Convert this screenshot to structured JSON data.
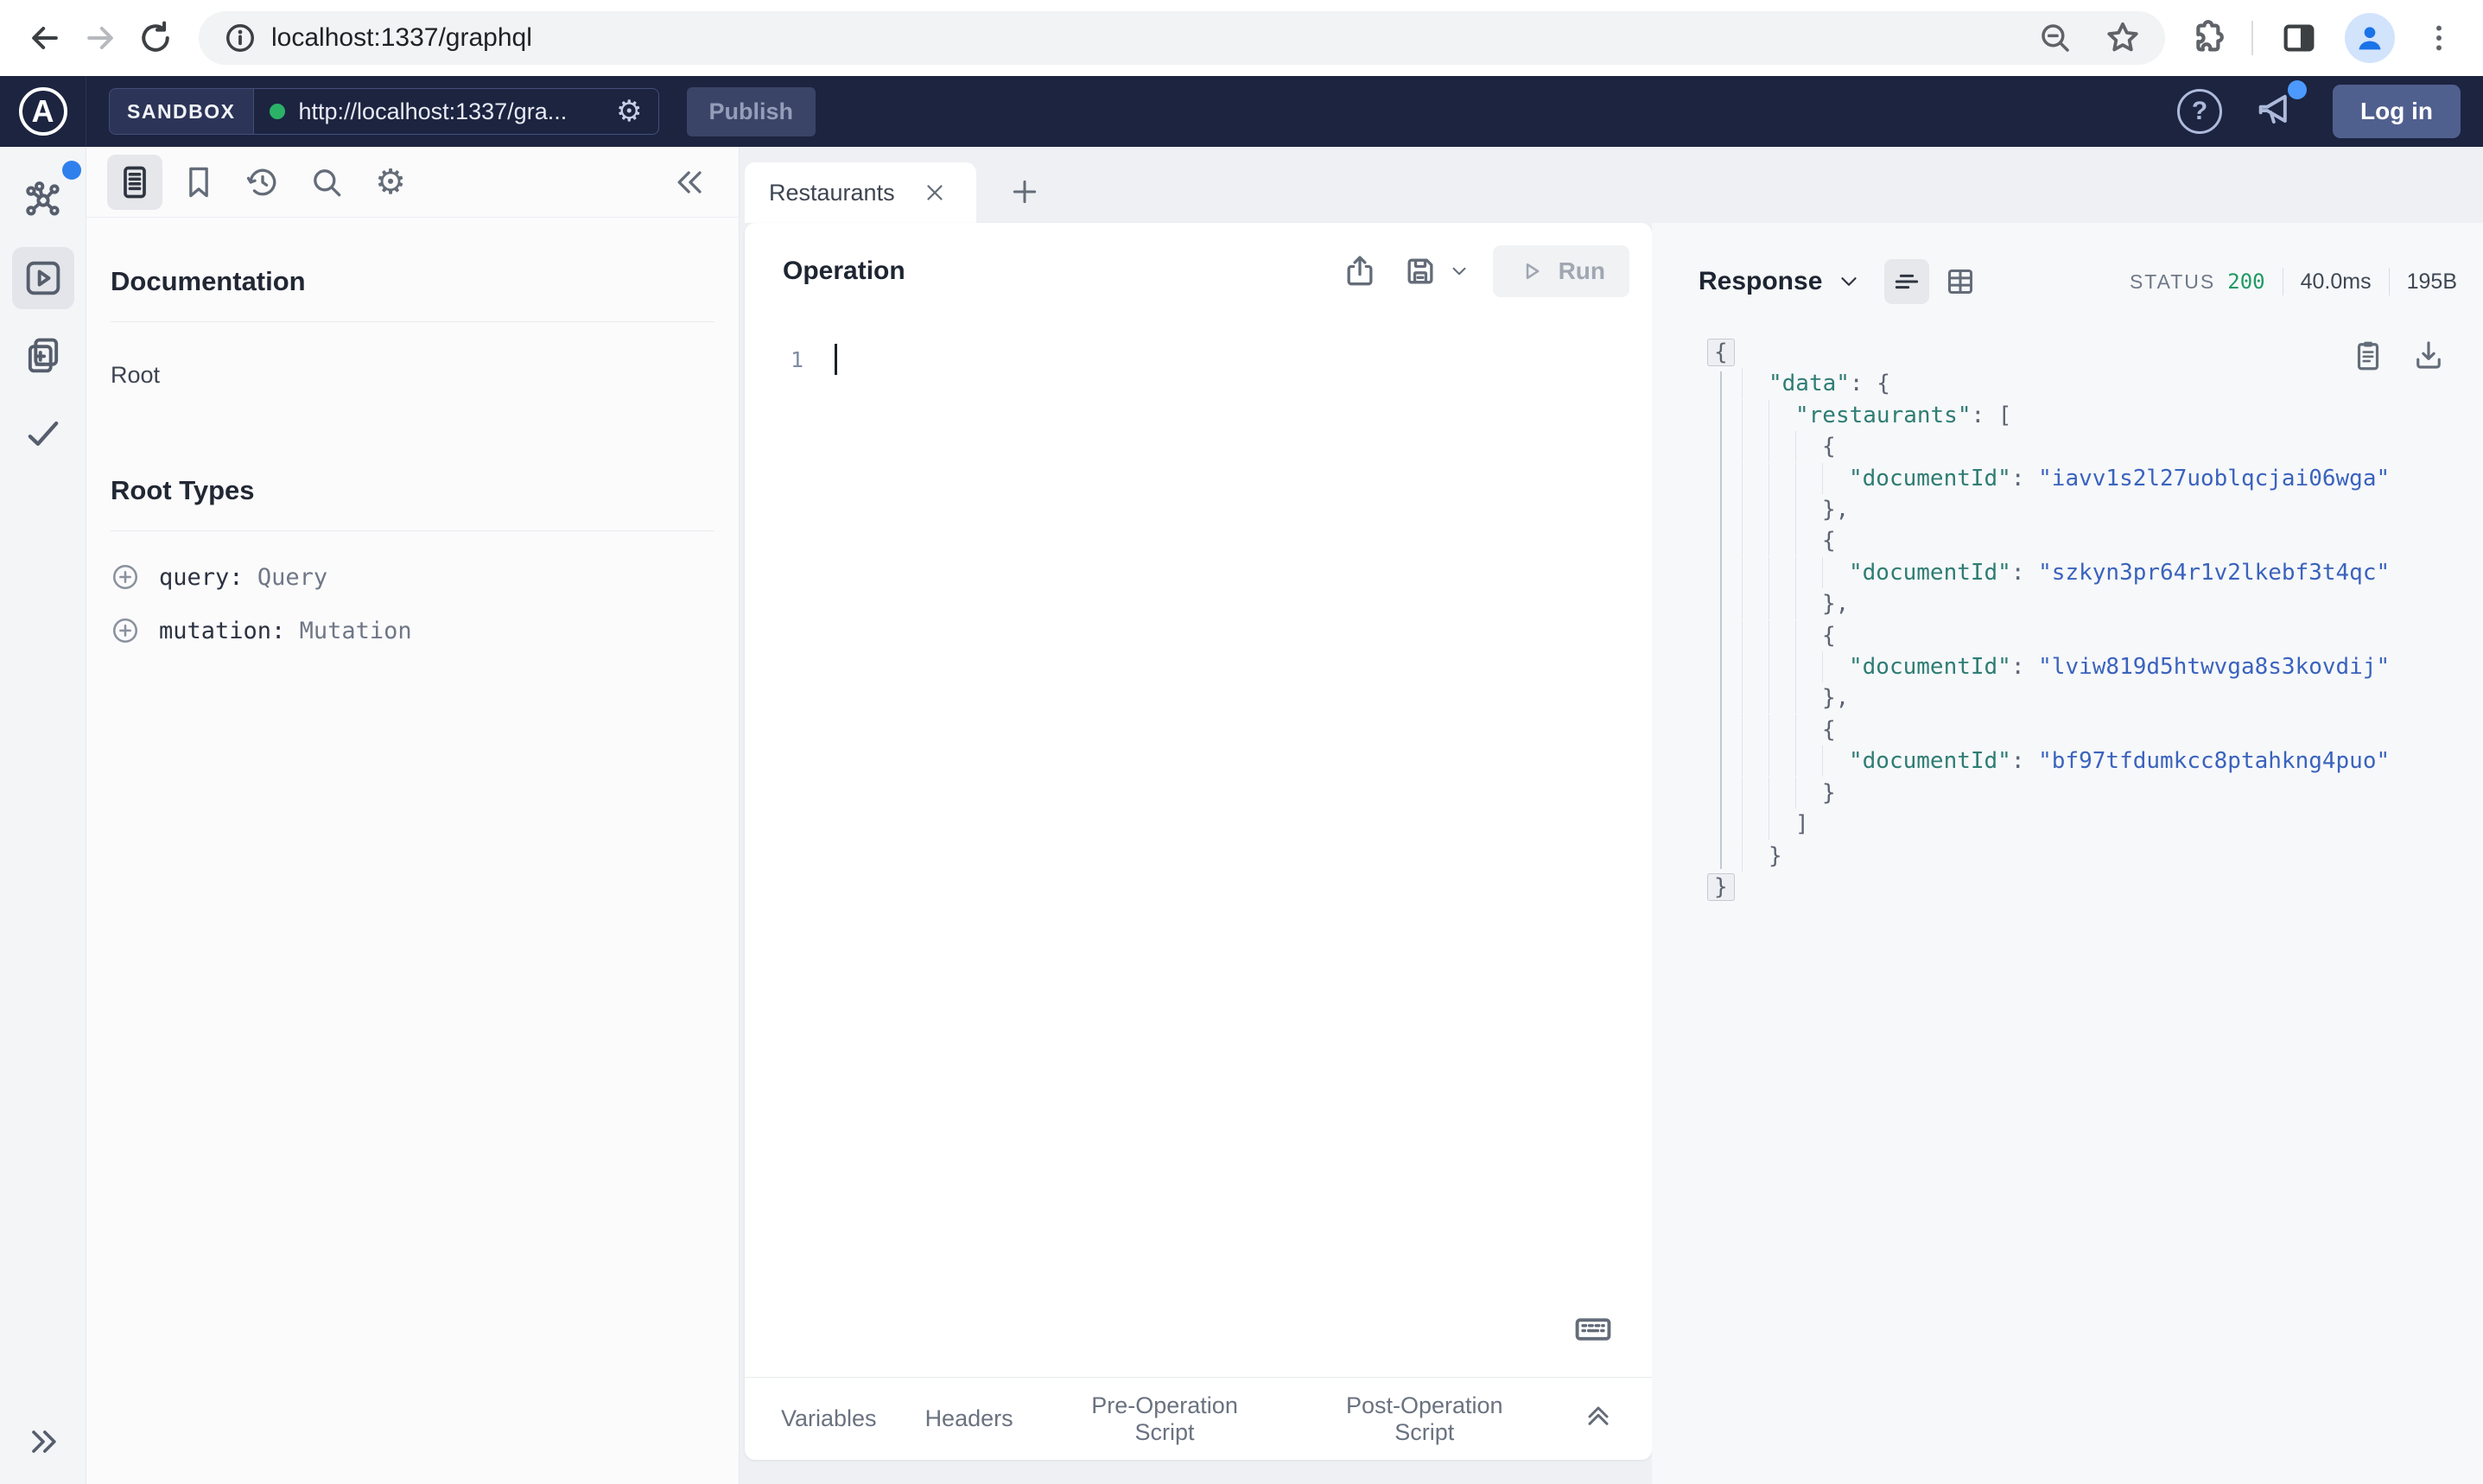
{
  "browser": {
    "url": "localhost:1337/graphql"
  },
  "header": {
    "logo_letter": "A",
    "sandbox_label": "SANDBOX",
    "endpoint_url": "http://localhost:1337/gra...",
    "publish_label": "Publish",
    "help_label": "?",
    "login_label": "Log in"
  },
  "docs": {
    "title": "Documentation",
    "root_item": "Root",
    "root_types_title": "Root Types",
    "types": [
      {
        "field": "query:",
        "type": "Query"
      },
      {
        "field": "mutation:",
        "type": "Mutation"
      }
    ]
  },
  "tabs": {
    "active_tab": "Restaurants"
  },
  "operation": {
    "title": "Operation",
    "run_label": "Run",
    "line_number": "1",
    "footer_tabs": [
      "Variables",
      "Headers",
      "Pre-Operation Script",
      "Post-Operation Script"
    ]
  },
  "response": {
    "title": "Response",
    "status_label": "STATUS",
    "status_code": "200",
    "duration": "40.0ms",
    "size": "195B",
    "json_lines": [
      {
        "indent": 0,
        "box": true,
        "segs": [
          [
            "p",
            "{"
          ]
        ]
      },
      {
        "indent": 1,
        "box": false,
        "segs": [
          [
            "k",
            "\"data\""
          ],
          [
            "p",
            ": {"
          ]
        ]
      },
      {
        "indent": 2,
        "box": false,
        "segs": [
          [
            "k",
            "\"restaurants\""
          ],
          [
            "p",
            ": ["
          ]
        ]
      },
      {
        "indent": 3,
        "box": false,
        "segs": [
          [
            "p",
            "{"
          ]
        ]
      },
      {
        "indent": 4,
        "box": false,
        "segs": [
          [
            "k",
            "\"documentId\""
          ],
          [
            "p",
            ": "
          ],
          [
            "v",
            "\"iavv1s2l27uoblqcjai06wga\""
          ]
        ]
      },
      {
        "indent": 3,
        "box": false,
        "segs": [
          [
            "p",
            "},"
          ]
        ]
      },
      {
        "indent": 3,
        "box": false,
        "segs": [
          [
            "p",
            "{"
          ]
        ]
      },
      {
        "indent": 4,
        "box": false,
        "segs": [
          [
            "k",
            "\"documentId\""
          ],
          [
            "p",
            ": "
          ],
          [
            "v",
            "\"szkyn3pr64r1v2lkebf3t4qc\""
          ]
        ]
      },
      {
        "indent": 3,
        "box": false,
        "segs": [
          [
            "p",
            "},"
          ]
        ]
      },
      {
        "indent": 3,
        "box": false,
        "segs": [
          [
            "p",
            "{"
          ]
        ]
      },
      {
        "indent": 4,
        "box": false,
        "segs": [
          [
            "k",
            "\"documentId\""
          ],
          [
            "p",
            ": "
          ],
          [
            "v",
            "\"lviw819d5htwvga8s3kovdij\""
          ]
        ]
      },
      {
        "indent": 3,
        "box": false,
        "segs": [
          [
            "p",
            "},"
          ]
        ]
      },
      {
        "indent": 3,
        "box": false,
        "segs": [
          [
            "p",
            "{"
          ]
        ]
      },
      {
        "indent": 4,
        "box": false,
        "segs": [
          [
            "k",
            "\"documentId\""
          ],
          [
            "p",
            ": "
          ],
          [
            "v",
            "\"bf97tfdumkcc8ptahkng4puo\""
          ]
        ]
      },
      {
        "indent": 3,
        "box": false,
        "segs": [
          [
            "p",
            "}"
          ]
        ]
      },
      {
        "indent": 2,
        "box": false,
        "segs": [
          [
            "p",
            "]"
          ]
        ]
      },
      {
        "indent": 1,
        "box": false,
        "segs": [
          [
            "p",
            "}"
          ]
        ]
      },
      {
        "indent": 0,
        "box": true,
        "segs": [
          [
            "p",
            "}"
          ]
        ]
      }
    ]
  },
  "colors": {
    "header_bg": "#1c2440",
    "accent_blue": "#2f80ed",
    "status_green": "#1f9a63",
    "json_key": "#2e7d74",
    "json_value": "#3a63bd"
  }
}
